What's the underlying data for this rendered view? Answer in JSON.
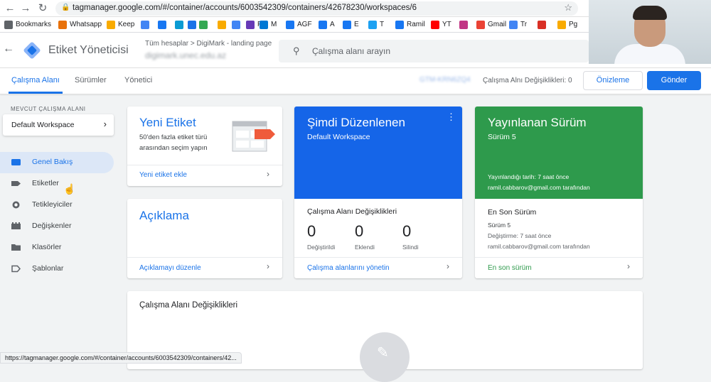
{
  "browser": {
    "url": "tagmanager.google.com/#/container/accounts/6003542309/containers/42678230/workspaces/6",
    "status_url": "https://tagmanager.google.com/#/container/accounts/6003542309/containers/42...",
    "bookmarks": [
      {
        "label": "Bookmarks",
        "icon": "star-icon",
        "color": "#5f6368"
      },
      {
        "label": "Whatsapp",
        "icon": "whatsapp-icon",
        "color": "#e8710a"
      },
      {
        "label": "Keep",
        "icon": "keep-icon",
        "color": "#f9ab00"
      },
      {
        "label": "",
        "icon": "chrome-icon",
        "color": "#4285f4"
      },
      {
        "label": "",
        "icon": "facebook-icon",
        "color": "#1877f2"
      },
      {
        "label": "",
        "icon": "trello-icon",
        "color": "#0a9bd3"
      },
      {
        "label": "C",
        "icon": "calendar-icon",
        "color": "#1a73e8"
      },
      {
        "label": "",
        "icon": "drive-icon",
        "color": "#34a853"
      },
      {
        "label": "",
        "icon": "analytics-icon",
        "color": "#f9ab00"
      },
      {
        "label": "",
        "icon": "gtm-icon",
        "color": "#4285f4"
      },
      {
        "label": "F",
        "icon": "forms-icon",
        "color": "#673ab7"
      },
      {
        "label": "M",
        "icon": "outlook-icon",
        "color": "#0078d4"
      },
      {
        "label": "AGF",
        "icon": "facebook-icon",
        "color": "#1877f2"
      },
      {
        "label": "A",
        "icon": "facebook-icon",
        "color": "#1877f2"
      },
      {
        "label": "E",
        "icon": "facebook-icon",
        "color": "#1877f2"
      },
      {
        "label": "T",
        "icon": "twitter-icon",
        "color": "#1da1f2"
      },
      {
        "label": "Ramil",
        "icon": "facebook-icon",
        "color": "#1877f2"
      },
      {
        "label": "YT",
        "icon": "youtube-icon",
        "color": "#ff0000"
      },
      {
        "label": "",
        "icon": "instagram-icon",
        "color": "#c13584"
      },
      {
        "label": "Gmail",
        "icon": "gmail-icon",
        "color": "#ea4335"
      },
      {
        "label": "Tr",
        "icon": "translate-icon",
        "color": "#4285f4"
      },
      {
        "label": "",
        "icon": "flash-icon",
        "color": "#d93025"
      },
      {
        "label": "Pg",
        "icon": "page-icon",
        "color": "#f9ab00"
      }
    ]
  },
  "header": {
    "app_title": "Etiket Yöneticisi",
    "breadcrumb_accounts": "Tüm hesaplar",
    "breadcrumb_sep": ">",
    "breadcrumb_account": "DigiMark - landing page",
    "container_name": "digimark.unec.edu.az",
    "search_placeholder": "Çalışma alanı arayın"
  },
  "tabs": {
    "workspace": "Çalışma Alanı",
    "versions": "Sürümler",
    "admin": "Yönetici",
    "workspace_id": "GTM-KRN6ZQ4",
    "changes_label": "Çalışma Alnı Değişiklikleri: 0",
    "preview": "Önizleme",
    "submit": "Gönder"
  },
  "sidebar": {
    "current_label": "MEVCUT ÇALIŞMA ALANI",
    "workspace": "Default Workspace",
    "items": [
      {
        "label": "Genel Bakış",
        "icon": "overview-icon",
        "active": true
      },
      {
        "label": "Etiketler",
        "icon": "tag-icon",
        "active": false
      },
      {
        "label": "Tetikleyiciler",
        "icon": "trigger-icon",
        "active": false
      },
      {
        "label": "Değişkenler",
        "icon": "variables-icon",
        "active": false
      },
      {
        "label": "Klasörler",
        "icon": "folder-icon",
        "active": false
      },
      {
        "label": "Şablonlar",
        "icon": "template-icon",
        "active": false
      }
    ]
  },
  "cards": {
    "new_tag": {
      "title": "Yeni Etiket",
      "desc1": "50'den fazla etiket türü",
      "desc2": "arasından seçim yapın",
      "link": "Yeni etiket ekle"
    },
    "description": {
      "title": "Açıklama",
      "link": "Açıklamayı düzenle"
    },
    "editing": {
      "title": "Şimdi Düzenlenen",
      "subtitle": "Default Workspace",
      "changes_title": "Çalışma Alanı Değişiklikleri",
      "modified_value": "0",
      "modified_label": "Değiştirildi",
      "added_value": "0",
      "added_label": "Eklendi",
      "deleted_value": "0",
      "deleted_label": "Silindi",
      "link": "Çalışma alanlarını yönetin"
    },
    "published": {
      "title": "Yayınlanan Sürüm",
      "subtitle": "Sürüm 5",
      "published_date": "Yayınlandığı tarih: 7 saat önce",
      "published_by": "ramil.cabbarov@gmail.com tarafından",
      "latest_title": "En Son Sürüm",
      "latest_version": "Sürüm 5",
      "latest_modified": "Değiştirme: 7 saat önce",
      "latest_by": "ramil.cabbarov@gmail.com tarafından",
      "link": "En son sürüm"
    },
    "ws_changes": {
      "title": "Çalışma Alanı Değişiklikleri"
    }
  },
  "colors": {
    "accent": "#1a73e8",
    "editing_card": "#1565e8",
    "published_card": "#2e9a4c"
  }
}
